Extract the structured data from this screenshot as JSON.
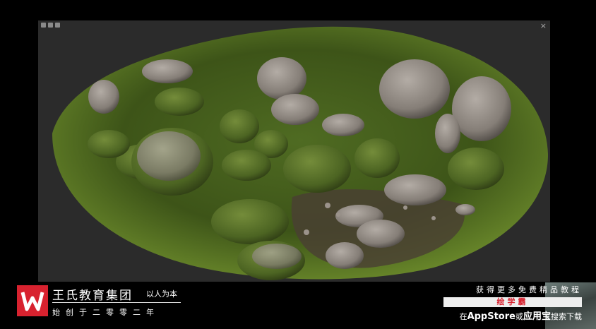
{
  "window": {
    "close_glyph": "×",
    "controls": [
      "minimize-icon",
      "maximize-icon",
      "restore-icon"
    ]
  },
  "scene": {
    "subject": "moss-covered rock patch 3D scan",
    "colors": {
      "background": "#2b2b2b",
      "moss": "#5a7a2a",
      "rock": "#8c8680",
      "soil": "#4a3f33"
    }
  },
  "brand": {
    "logo_icon": "wangshi-w-logo",
    "logo_color": "#d8222f",
    "name": "王氏教育集团",
    "slogan": "以人为本",
    "since": "始创于二零零二年"
  },
  "promo": {
    "line1": "获得更多免费精品教程",
    "app_name": "绘学霸",
    "line3_prefix": "在",
    "store1": "AppStore",
    "line3_or": "或",
    "store2": "应用宝",
    "line3_suffix": "搜索下载",
    "accent": "#d8222f"
  }
}
